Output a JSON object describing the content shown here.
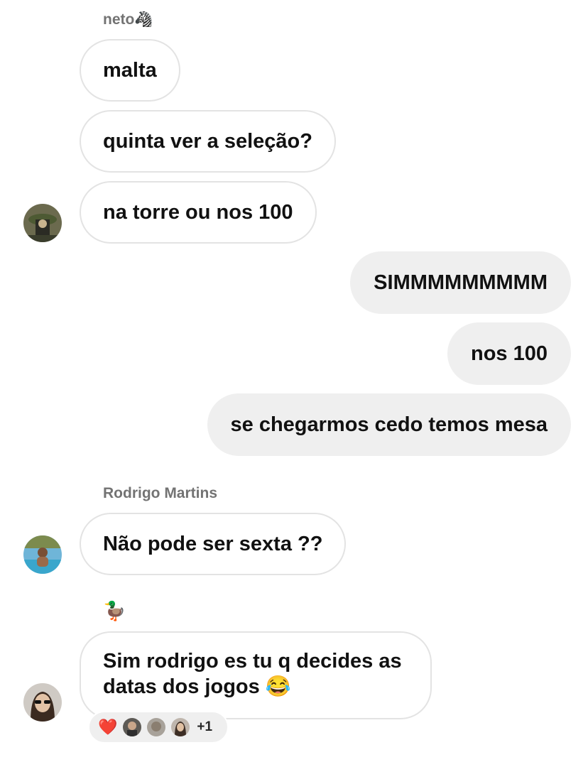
{
  "senders": {
    "neto": "neto🦓",
    "rodrigo": "Rodrigo Martins",
    "duck": "🦆"
  },
  "messages": {
    "m1": "malta",
    "m2": "quinta ver a seleção?",
    "m3": "na torre ou nos 100",
    "m4": "SIMMMMMMMMM",
    "m5": "nos 100",
    "m6": "se chegarmos cedo temos mesa",
    "m7": "Não pode ser sexta ??",
    "m8_line1": "Sim rodrigo es tu q decides as",
    "m8_line2": "datas dos jogos 😂"
  },
  "reactions": {
    "emoji": "❤️",
    "count": "+1"
  },
  "icons": {
    "heart": "heart-icon"
  }
}
